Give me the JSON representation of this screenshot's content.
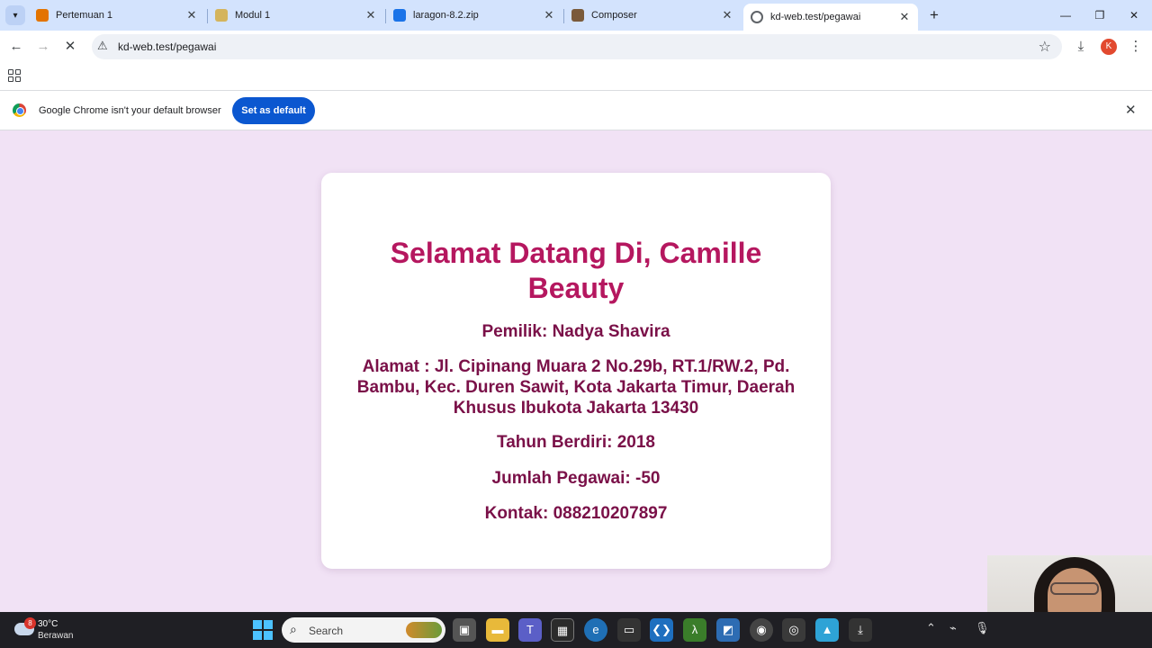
{
  "browser": {
    "tabs": [
      {
        "label": "Pertemuan 1",
        "favicon_color": "#e37400"
      },
      {
        "label": "Modul 1",
        "favicon_color": "#d4b45c"
      },
      {
        "label": "laragon-8.2.zip",
        "favicon_color": "#1a73e8"
      },
      {
        "label": "Composer",
        "favicon_color": "#7a5a3a"
      },
      {
        "label": "kd-web.test/pegawai",
        "favicon_color": "#5f6368"
      }
    ],
    "new_tab_symbol": "+",
    "url": "kd-web.test/pegawai",
    "infobar_text": "Google Chrome isn't your default browser",
    "set_default_label": "Set as default",
    "profile_initial": "K"
  },
  "page": {
    "title": "Selamat Datang Di, Camille Beauty",
    "owner": "Pemilik: Nadya Shavira",
    "address": "Alamat : Jl. Cipinang Muara 2 No.29b, RT.1/RW.2, Pd. Bambu, Kec. Duren Sawit, Kota Jakarta Timur, Daerah Khusus Ibukota Jakarta 13430",
    "year_founded": "Tahun Berdiri: 2018",
    "employees": "Jumlah Pegawai: -50",
    "contact": "Kontak: 088210207897",
    "title_color": "#b5175f",
    "text_color": "#7a1048",
    "background_color": "#f1e2f5"
  },
  "taskbar": {
    "weather_badge": "8",
    "weather_temp": "30°C",
    "weather_desc": "Berawan",
    "search_placeholder": "Search"
  }
}
